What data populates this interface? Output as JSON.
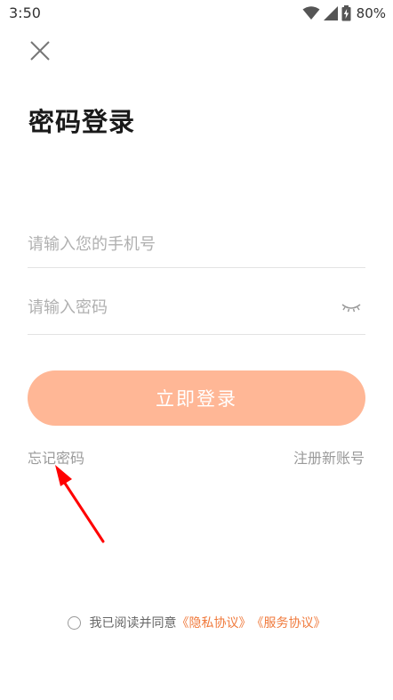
{
  "status_bar": {
    "time": "3:50",
    "battery": "80%",
    "icons": [
      "wifi-icon",
      "signal-icon",
      "battery-charging-icon"
    ]
  },
  "header": {
    "close_icon": "close-icon",
    "title": "密码登录"
  },
  "form": {
    "phone": {
      "placeholder": "请输入您的手机号",
      "value": ""
    },
    "password": {
      "placeholder": "请输入密码",
      "value": "",
      "toggle_icon": "eye-closed-icon"
    },
    "submit_label": "立即登录"
  },
  "links": {
    "forgot": "忘记密码",
    "register": "注册新账号"
  },
  "agreement": {
    "text": "我已阅读并同意",
    "privacy": "《隐私协议》",
    "service": "《服务协议》",
    "checked": false
  },
  "colors": {
    "accent": "#ffb796",
    "link": "#f07a3c",
    "annotation": "#ff0000"
  }
}
